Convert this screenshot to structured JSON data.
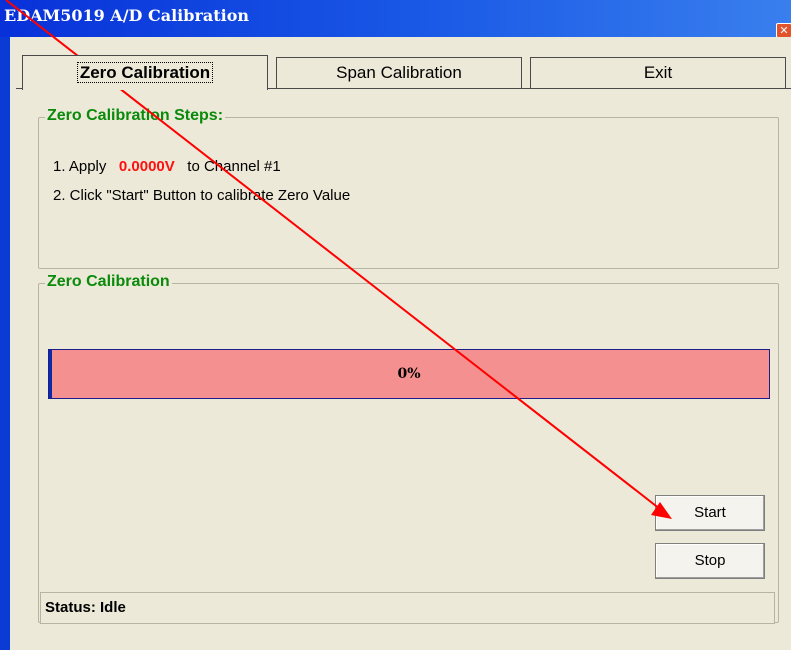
{
  "window": {
    "title": "EDAM5019 A/D Calibration",
    "close_glyph": "✕"
  },
  "tabs": [
    {
      "label": "Zero Calibration",
      "active": true
    },
    {
      "label": "Span Calibration",
      "active": false
    },
    {
      "label": "Exit",
      "active": false
    }
  ],
  "steps_group": {
    "legend": "Zero Calibration Steps:",
    "step1_prefix": "1. Apply",
    "step1_value": "0.0000V",
    "step1_suffix": "to Channel #1",
    "step2": "2. Click \"Start\" Button to calibrate Zero Value"
  },
  "calibration_group": {
    "legend": "Zero Calibration",
    "progress_text": "0%",
    "progress_value": 0
  },
  "buttons": {
    "start": "Start",
    "stop": "Stop"
  },
  "status": {
    "text": "Status: Idle"
  },
  "colors": {
    "title_bar": "#0831d9",
    "legend_text": "#0a8a0a",
    "highlight_value": "#ff1010",
    "progress_bg": "#f59090",
    "annotation_arrow": "#ff0000"
  }
}
